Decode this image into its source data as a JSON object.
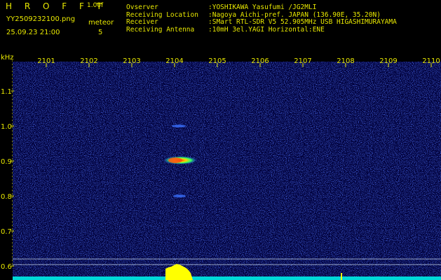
{
  "header": {
    "app_name": "H R O F F T",
    "version": "1.00f",
    "filename": "YY2509232100.png",
    "mode": "meteor",
    "datetime": "25.09.23 21:00",
    "count": "5",
    "info": [
      {
        "key": "Ovserver",
        "value": ":YOSHIKAWA Yasufumi /JG2MLI"
      },
      {
        "key": "Receiving Location",
        "value": ":Nagoya Aichi-pref. JAPAN (136.90E, 35.20N)"
      },
      {
        "key": "Receiver",
        "value": ":SMart RTL-SDR V5 52.905MHz USB HIGASHIMURAYAMA"
      },
      {
        "key": "Receiving Antenna",
        "value": ":10mH 3el.YAGI Horizontal:ENE"
      }
    ]
  },
  "spectrogram": {
    "y_unit": "kHz",
    "y_ticks": [
      {
        "label": "1.1",
        "value": 1.1
      },
      {
        "label": "1.0",
        "value": 1.0
      },
      {
        "label": "0.9",
        "value": 0.9
      },
      {
        "label": "0.8",
        "value": 0.8
      },
      {
        "label": "0.7",
        "value": 0.7
      },
      {
        "label": "0.6",
        "value": 0.6
      }
    ],
    "time_ticks": [
      "2101",
      "2102",
      "2103",
      "2104",
      "2105",
      "2106",
      "2107",
      "2108",
      "2109",
      "2110"
    ],
    "colors": {
      "background": "#00003a",
      "noise": "#1a3cff",
      "label": "#e8e800",
      "level_line": "#9aa8c8",
      "level_fill": "#00d8d8",
      "meteor": "#ffff00"
    }
  }
}
